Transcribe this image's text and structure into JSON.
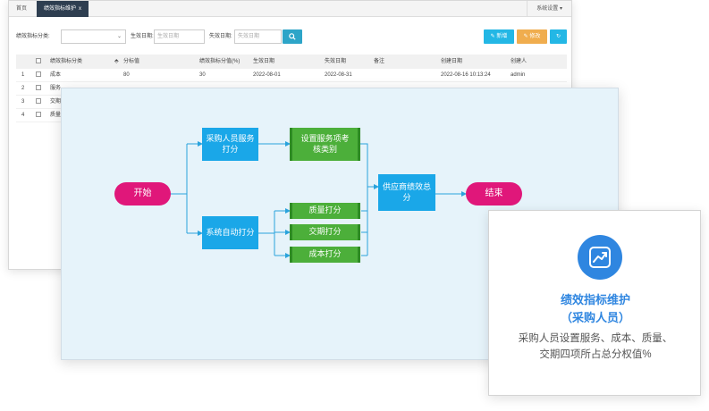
{
  "tabs": {
    "home": "首页",
    "active": "绩效指标维护",
    "close": "x",
    "right_menu": "系统设置"
  },
  "search": {
    "category_label": "绩效指标分类:",
    "effective_label": "生效日期:",
    "effective_placeholder": "生效日期",
    "expire_label": "失效日期:",
    "expire_placeholder": "失效日期"
  },
  "toolbar": {
    "add": "新增",
    "edit": "修改"
  },
  "table": {
    "headers": [
      "绩效指标分类",
      "分标值",
      "绩效指标分值(%)",
      "生效日期",
      "失效日期",
      "备注",
      "创建日期",
      "创建人"
    ],
    "rows": [
      {
        "no": "1",
        "category": "成本",
        "value": "80",
        "score": "30",
        "start": "2022-08-01",
        "end": "2022-08-31",
        "note": "",
        "created": "2022-08-16 10:13:24",
        "creator": "admin"
      },
      {
        "no": "2",
        "category": "服务"
      },
      {
        "no": "3",
        "category": "交期"
      },
      {
        "no": "4",
        "category": "质量"
      }
    ]
  },
  "flow": {
    "start": "开始",
    "buyer_score": "采购人员服务\n打分",
    "set_items": "设置服务项考\n核类别",
    "auto_score": "系统自动打分",
    "quality": "质量打分",
    "delivery": "交期打分",
    "cost": "成本打分",
    "supplier_total": "供应商绩效总\n分",
    "end": "结束"
  },
  "info": {
    "icon": "chart-trend-icon",
    "title_line1": "绩效指标维护",
    "title_line2": "（采购人员）",
    "desc_line1": "采购人员设置服务、成本、质量、",
    "desc_line2": "交期四项所占总分权值%"
  },
  "colors": {
    "accent": "#2f86e0",
    "pill": "#e0177a",
    "blue_node": "#1aa7e8",
    "green_node": "#4caf3a",
    "tab_dark": "#2e3e50"
  }
}
